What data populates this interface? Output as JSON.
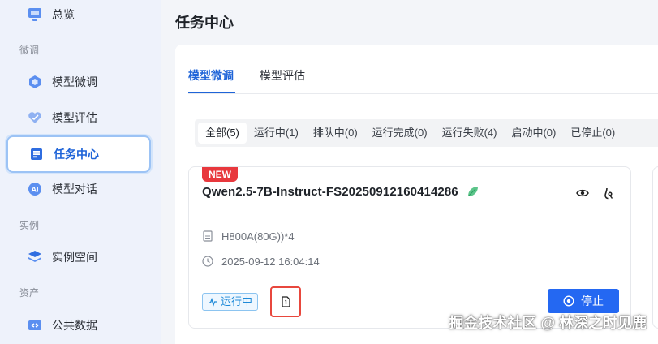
{
  "sidebar": {
    "items": [
      {
        "label": "总览",
        "icon": "dashboard-icon"
      },
      {
        "label": "模型微调",
        "icon": "model-finetune-icon"
      },
      {
        "label": "模型评估",
        "icon": "model-eval-icon"
      },
      {
        "label": "任务中心",
        "icon": "task-center-icon"
      },
      {
        "label": "模型对话",
        "icon": "chat-icon"
      },
      {
        "label": "实例空间",
        "icon": "layers-icon"
      },
      {
        "label": "公共数据",
        "icon": "public-data-icon"
      }
    ],
    "sections": {
      "finetune": "微调",
      "instance": "实例",
      "assets": "资产"
    }
  },
  "page": {
    "title": "任务中心"
  },
  "tabs": [
    {
      "label": "模型微调",
      "active": true
    },
    {
      "label": "模型评估",
      "active": false
    }
  ],
  "filters": [
    {
      "label": "全部(5)",
      "active": true
    },
    {
      "label": "运行中(1)",
      "active": false
    },
    {
      "label": "排队中(0)",
      "active": false
    },
    {
      "label": "运行完成(0)",
      "active": false
    },
    {
      "label": "运行失败(4)",
      "active": false
    },
    {
      "label": "启动中(0)",
      "active": false
    },
    {
      "label": "已停止(0)",
      "active": false
    }
  ],
  "task_card": {
    "badge": "NEW",
    "title": "Qwen2.5-7B-Instruct-FS20250912160414286",
    "gpu": "H800A(80G))*4",
    "created_at": "2025-09-12 16:04:14",
    "status": "运行中",
    "stop_label": "停止"
  },
  "watermark": "掘金技术社区 @ 林深之时见鹿",
  "colors": {
    "accent": "#2468f2",
    "tab_active": "#1f64d8",
    "new_badge": "#e8383d",
    "highlight_box": "#e8473d",
    "status_blue": "#1f8ad8"
  }
}
